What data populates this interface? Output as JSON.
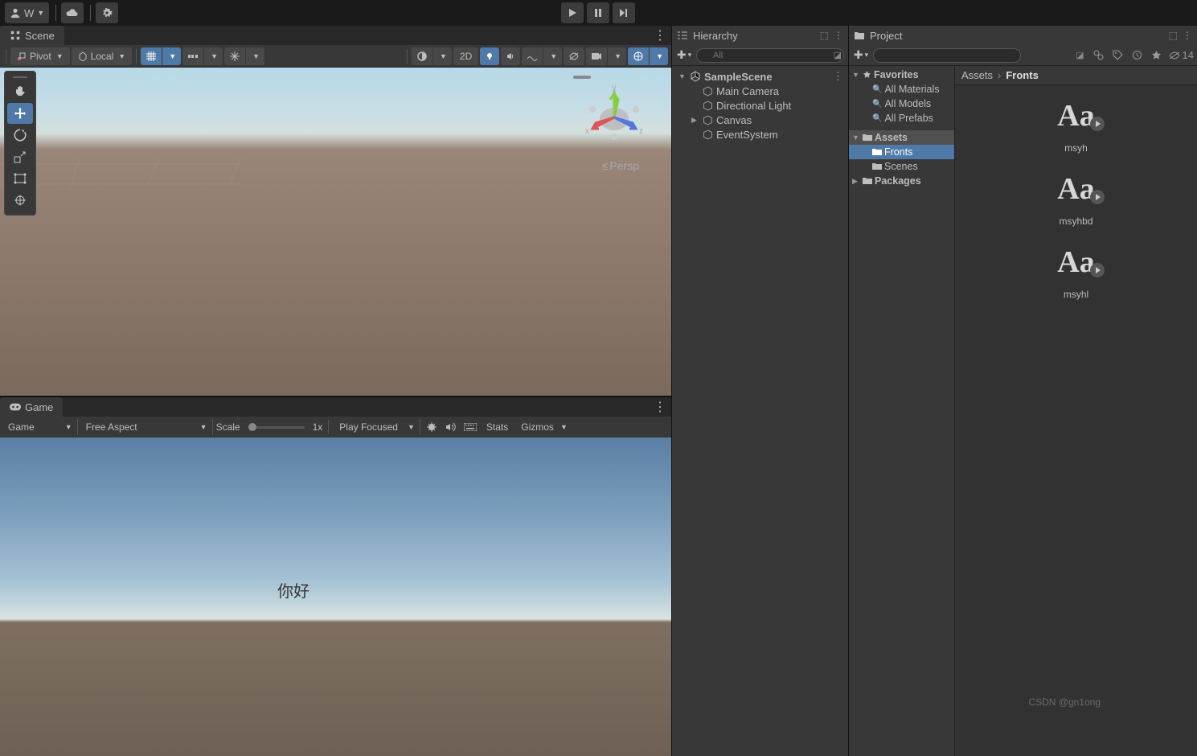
{
  "top": {
    "account_label": "W",
    "play": "play",
    "pause": "pause",
    "step": "step"
  },
  "scene": {
    "tab_label": "Scene",
    "pivot_label": "Pivot",
    "local_label": "Local",
    "btn_2d": "2D",
    "persp_label": "Persp",
    "axis_x": "x",
    "axis_y": "y",
    "axis_z": "z"
  },
  "game": {
    "tab_label": "Game",
    "display_dd": "Game",
    "aspect_dd": "Free Aspect",
    "scale_label": "Scale",
    "scale_value": "1x",
    "play_focused": "Play Focused",
    "stats": "Stats",
    "gizmos": "Gizmos",
    "canvas_text": "你好"
  },
  "hierarchy": {
    "title": "Hierarchy",
    "search_placeholder": "All",
    "scene_name": "SampleScene",
    "items": [
      {
        "label": "Main Camera"
      },
      {
        "label": "Directional Light"
      },
      {
        "label": "Canvas",
        "expandable": true
      },
      {
        "label": "EventSystem"
      }
    ]
  },
  "project": {
    "title": "Project",
    "search_placeholder": "",
    "hidden_count": "14",
    "favorites_label": "Favorites",
    "favorites": [
      {
        "label": "All Materials"
      },
      {
        "label": "All Models"
      },
      {
        "label": "All Prefabs"
      }
    ],
    "assets_label": "Assets",
    "assets_children": [
      {
        "label": "Fronts",
        "selected": true
      },
      {
        "label": "Scenes"
      }
    ],
    "packages_label": "Packages",
    "breadcrumb": {
      "root": "Assets",
      "current": "Fronts"
    },
    "assets": [
      {
        "label": "msyh"
      },
      {
        "label": "msyhbd"
      },
      {
        "label": "msyhl"
      }
    ]
  },
  "watermark": "CSDN @gn1ong"
}
